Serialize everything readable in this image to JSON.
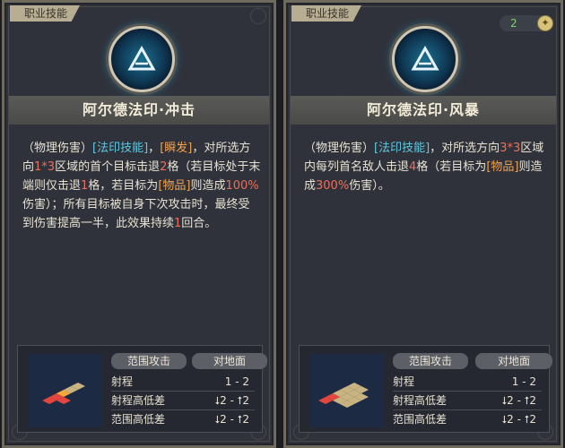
{
  "cards": [
    {
      "category": "职业技能",
      "title": "阿尔德法印·冲击",
      "desc": [
        {
          "t": "（物理伤害）",
          "c": ""
        },
        {
          "t": "[法印技能]",
          "c": "cyan"
        },
        {
          "t": "，",
          "c": ""
        },
        {
          "t": "[瞬发]",
          "c": "orange"
        },
        {
          "t": "，对所选方向",
          "c": ""
        },
        {
          "t": "1*3",
          "c": "red"
        },
        {
          "t": "区域的首个目标击退",
          "c": ""
        },
        {
          "t": "2",
          "c": "red"
        },
        {
          "t": "格（若目标处于末端则仅击退",
          "c": ""
        },
        {
          "t": "1",
          "c": "red"
        },
        {
          "t": "格，若目标为",
          "c": ""
        },
        {
          "t": "[物品]",
          "c": "orange"
        },
        {
          "t": "则造成",
          "c": ""
        },
        {
          "t": "100%",
          "c": "red"
        },
        {
          "t": "伤害）；所有目标被自身下次攻击时，最终受到伤害提高一半，此效果持续",
          "c": ""
        },
        {
          "t": "1",
          "c": "red"
        },
        {
          "t": "回合。",
          "c": ""
        }
      ],
      "range_label": "范围攻击",
      "target_label": "对地面",
      "stats": [
        {
          "k": "射程",
          "v": "1 - 2"
        },
        {
          "k": "射程高低差",
          "v": "⭣2 - ⭡2"
        },
        {
          "k": "范围高低差",
          "v": "⭣2 - ⭡2"
        }
      ]
    },
    {
      "category": "职业技能",
      "title": "阿尔德法印·风暴",
      "counter": "2",
      "desc": [
        {
          "t": "（物理伤害）",
          "c": ""
        },
        {
          "t": "[法印技能]",
          "c": "cyan"
        },
        {
          "t": "，对所选方向",
          "c": ""
        },
        {
          "t": "3*3",
          "c": "red"
        },
        {
          "t": "区域内每列首名敌人击退",
          "c": ""
        },
        {
          "t": "4",
          "c": "red"
        },
        {
          "t": "格（若目标为",
          "c": ""
        },
        {
          "t": "[物品]",
          "c": "orange"
        },
        {
          "t": "则造成",
          "c": ""
        },
        {
          "t": "300%",
          "c": "red"
        },
        {
          "t": "伤害）。",
          "c": ""
        }
      ],
      "range_label": "范围攻击",
      "target_label": "对地面",
      "stats": [
        {
          "k": "射程",
          "v": "1 - 2"
        },
        {
          "k": "射程高低差",
          "v": "⭣2 - ⭡2"
        },
        {
          "k": "范围高低差",
          "v": "⭣2 - ⭡2"
        }
      ]
    }
  ]
}
